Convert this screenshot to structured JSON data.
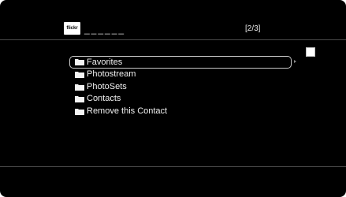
{
  "header": {
    "logo_text": "flickr",
    "user_name": "______",
    "page_indicator": "[2/3]"
  },
  "menu": {
    "items": [
      {
        "label": "Favorites",
        "icon": "folder-icon",
        "selected": true
      },
      {
        "label": "Photostream",
        "icon": "folder-icon",
        "selected": false
      },
      {
        "label": "PhotoSets",
        "icon": "folder-icon",
        "selected": false
      },
      {
        "label": "Contacts",
        "icon": "folder-icon",
        "selected": false
      },
      {
        "label": "Remove this Contact",
        "icon": "folder-icon",
        "selected": false
      }
    ]
  },
  "colors": {
    "background": "#000000",
    "text": "#f0f0f0",
    "selection_border": "#c8c8c8"
  }
}
